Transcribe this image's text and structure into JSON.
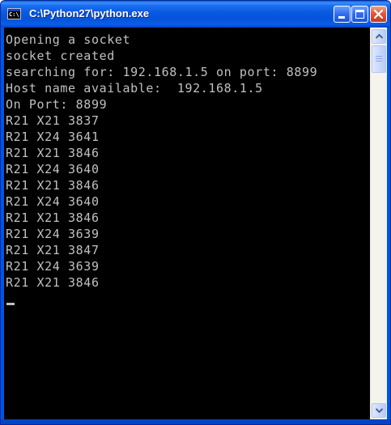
{
  "window": {
    "title": "C:\\Python27\\python.exe",
    "icon": "console-icon",
    "icon_glyph": "C:\\",
    "buttons": [
      "minimize",
      "maximize",
      "close"
    ]
  },
  "console": {
    "background": "#000000",
    "text_color": "#c0c0c0",
    "lines": [
      "Opening a socket",
      "socket created",
      "searching for: 192.168.1.5 on port: 8899",
      "Host name available:  192.168.1.5",
      "On Port: 8899",
      "R21 X21 3837",
      "R21 X24 3641",
      "R21 X21 3846",
      "R21 X24 3640",
      "R21 X21 3846",
      "R21 X24 3640",
      "R21 X21 3846",
      "R21 X24 3639",
      "R21 X21 3847",
      "R21 X24 3639",
      "R21 X21 3846"
    ]
  },
  "colors": {
    "titlebar": "#0055e5",
    "close_button": "#e0583a",
    "scrollbar": "#c7d6fb"
  }
}
